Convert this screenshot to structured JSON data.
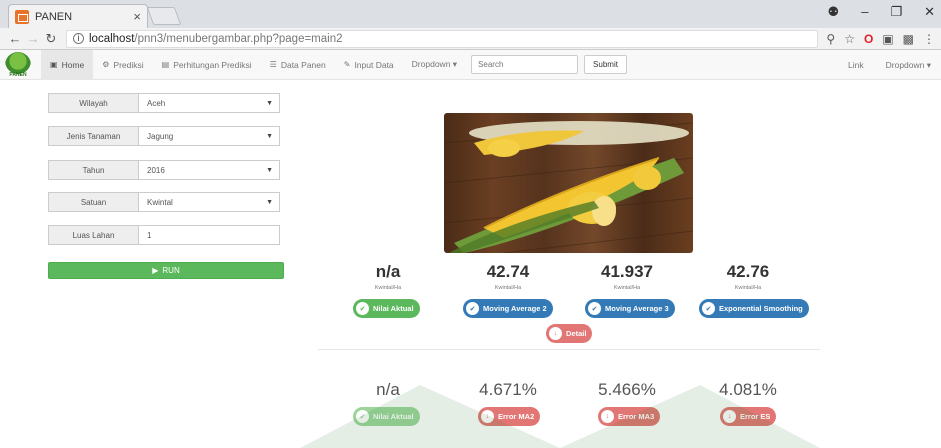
{
  "browser": {
    "tab_title": "PANEN",
    "tab_close": "×",
    "url_host": "localhost",
    "url_path": "/pnn3/menubergambar.php?page=main2",
    "window_controls": [
      "–",
      "❐",
      "✕"
    ]
  },
  "navbar": {
    "logo_text": "PANEN",
    "items": [
      {
        "label": "Home",
        "icon": "monitor-icon",
        "active": true
      },
      {
        "label": "Prediksi",
        "icon": "cogs-icon"
      },
      {
        "label": "Perhitungan Prediksi",
        "icon": "bar-chart-icon"
      },
      {
        "label": "Data Panen",
        "icon": "list-icon"
      },
      {
        "label": "Input Data",
        "icon": "edit-icon"
      },
      {
        "label": "Dropdown ▾"
      }
    ],
    "search_placeholder": "Search",
    "submit_label": "Submit",
    "right": {
      "link": "Link",
      "dropdown": "Dropdown ▾"
    }
  },
  "form": {
    "wilayah": {
      "label": "Wilayah",
      "value": "Aceh"
    },
    "jenis": {
      "label": "Jenis Tanaman",
      "value": "Jagung"
    },
    "tahun": {
      "label": "Tahun",
      "value": "2016"
    },
    "satuan": {
      "label": "Satuan",
      "value": "Kwintal"
    },
    "luas": {
      "label": "Luas Lahan",
      "value": "1"
    },
    "run_label": "RUN"
  },
  "results": {
    "aktual": {
      "value": "n/a",
      "unit": "Kwintal/Ha",
      "badge": "Nilai Aktual"
    },
    "ma2": {
      "value": "42.74",
      "unit": "Kwintal/Ha",
      "badge": "Moving Average 2"
    },
    "ma3": {
      "value": "41.937",
      "unit": "Kwintal/Ha",
      "badge": "Moving Average 3"
    },
    "es": {
      "value": "42.76",
      "unit": "Kwintal/Ha",
      "badge": "Exponential Smoothing"
    },
    "detail": "Detail"
  },
  "errors": {
    "aktual": {
      "value": "n/a",
      "badge": "Nilai Aktual"
    },
    "ma2": {
      "value": "4.671%",
      "badge": "Error MA2"
    },
    "ma3": {
      "value": "5.466%",
      "badge": "Error MA3"
    },
    "es": {
      "value": "4.081%",
      "badge": "Error ES"
    }
  }
}
